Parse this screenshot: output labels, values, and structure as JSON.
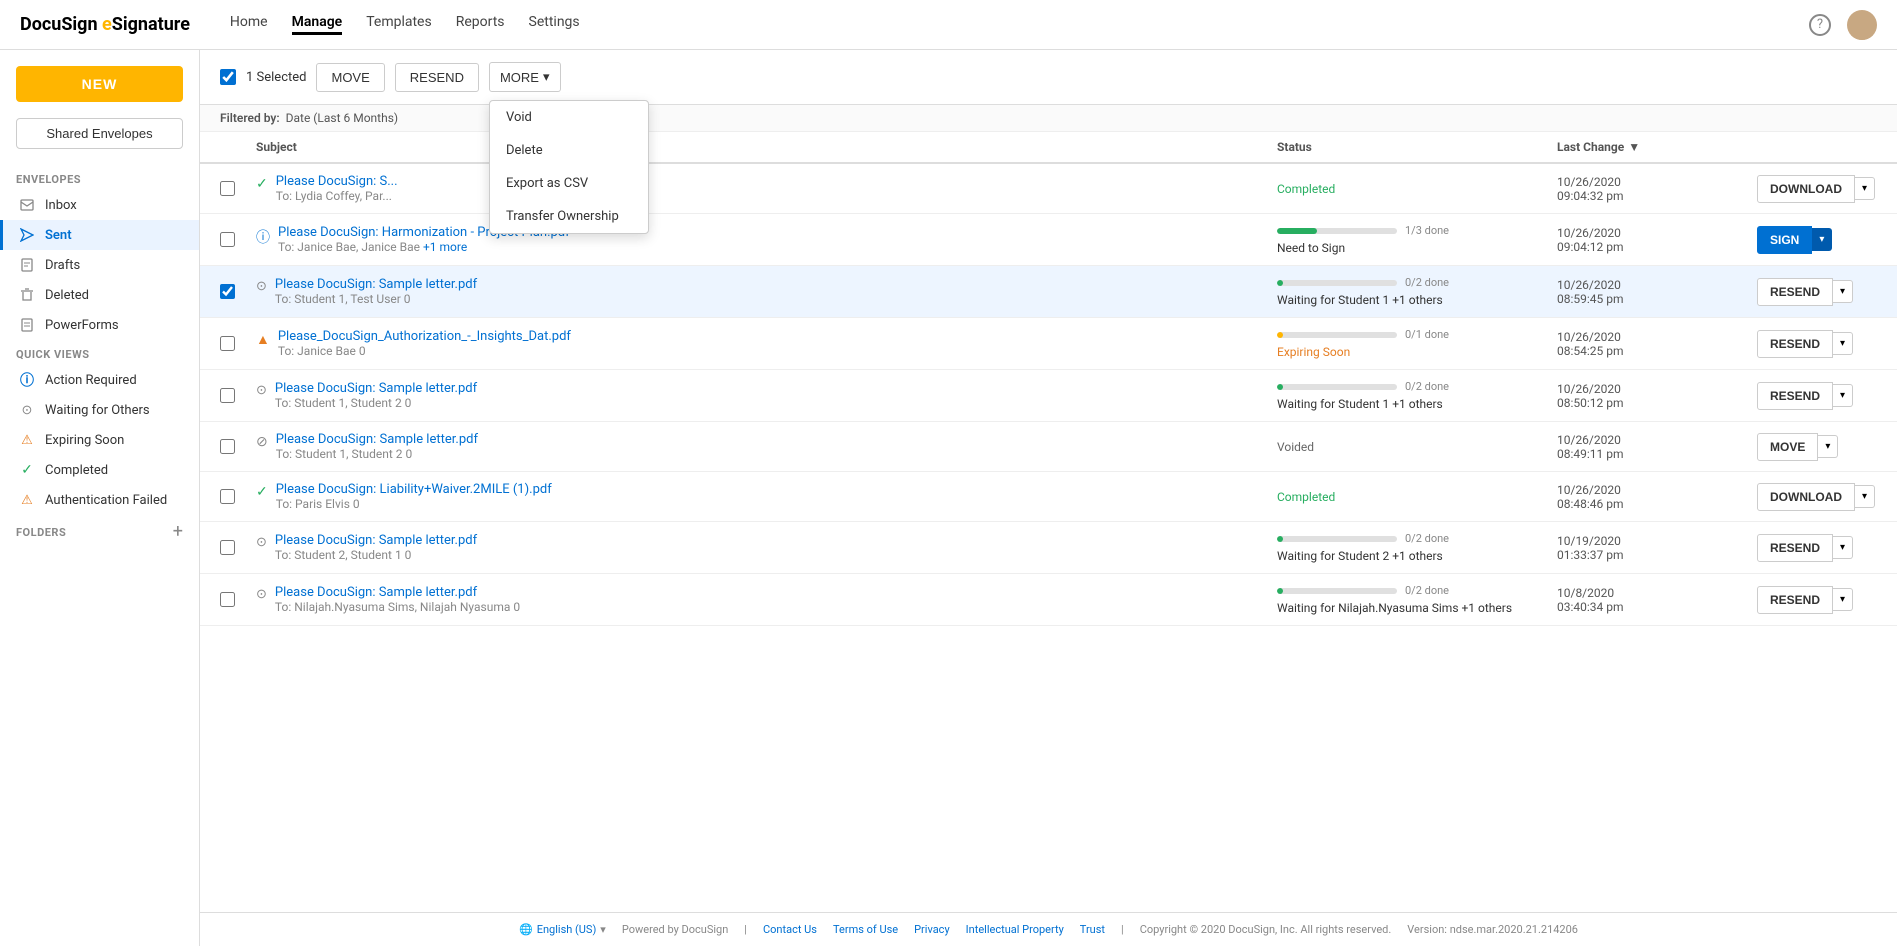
{
  "logo": {
    "brand": "DocuSign",
    "product": "eSignature"
  },
  "nav": {
    "links": [
      {
        "label": "Home",
        "active": false
      },
      {
        "label": "Manage",
        "active": true
      },
      {
        "label": "Templates",
        "active": false
      },
      {
        "label": "Reports",
        "active": false
      },
      {
        "label": "Settings",
        "active": false
      }
    ]
  },
  "sidebar": {
    "new_button": "NEW",
    "shared_button": "Shared Envelopes",
    "envelopes_label": "ENVELOPES",
    "envelopes_items": [
      {
        "id": "inbox",
        "label": "Inbox"
      },
      {
        "id": "sent",
        "label": "Sent",
        "active": true
      },
      {
        "id": "drafts",
        "label": "Drafts"
      },
      {
        "id": "deleted",
        "label": "Deleted"
      },
      {
        "id": "powerforms",
        "label": "PowerForms"
      }
    ],
    "quick_views_label": "QUICK VIEWS",
    "quick_views_items": [
      {
        "id": "action-required",
        "label": "Action Required"
      },
      {
        "id": "waiting-others",
        "label": "Waiting for Others"
      },
      {
        "id": "expiring-soon",
        "label": "Expiring Soon"
      },
      {
        "id": "completed",
        "label": "Completed"
      },
      {
        "id": "auth-failed",
        "label": "Authentication Failed"
      }
    ],
    "folders_label": "FOLDERS"
  },
  "toolbar": {
    "selected_count": "1 Selected",
    "move_label": "MOVE",
    "resend_label": "RESEND",
    "more_label": "MORE",
    "dropdown_items": [
      {
        "label": "Void"
      },
      {
        "label": "Delete"
      },
      {
        "label": "Export as CSV"
      },
      {
        "label": "Transfer Ownership"
      }
    ]
  },
  "filter_bar": {
    "label": "Filtered by:",
    "value": "Date (Last 6 Months)"
  },
  "table": {
    "headers": [
      "",
      "Subject",
      "Status",
      "Last Change",
      ""
    ],
    "rows": [
      {
        "id": "row1",
        "selected": false,
        "icon_type": "check-green",
        "subject": "Please DocuSign: S...",
        "to": "To: Lydia Coffey, Par...",
        "status_type": "completed",
        "status_text": "Completed",
        "progress": null,
        "progress_done": null,
        "progress_total": null,
        "date": "10/26/2020",
        "time": "09:04:32 pm",
        "action": "DOWNLOAD",
        "action_type": "download"
      },
      {
        "id": "row2",
        "selected": false,
        "icon_type": "info-blue",
        "subject": "Please DocuSign: Harmonization - Project Plan.pdf",
        "to": "To: Janice Bae, Janice Bae",
        "to_more": "+1 more",
        "status_type": "need-sign",
        "status_text": "Need to Sign",
        "progress": 33,
        "progress_done": "1/3",
        "progress_label": "done",
        "progress_color": "#27ae60",
        "date": "10/26/2020",
        "time": "09:04:12 pm",
        "action": "SIGN",
        "action_type": "sign"
      },
      {
        "id": "row3",
        "selected": true,
        "icon_type": "clock",
        "subject": "Please DocuSign: Sample letter.pdf",
        "to": "To: Student 1, Test User 0",
        "status_type": "waiting",
        "status_text": "Waiting for Student 1",
        "status_more": "+1 others",
        "progress": 5,
        "progress_done": "0/2",
        "progress_label": "done",
        "progress_color": "#27ae60",
        "date": "10/26/2020",
        "time": "08:59:45 pm",
        "action": "RESEND",
        "action_type": "resend"
      },
      {
        "id": "row4",
        "selected": false,
        "icon_type": "warn-yellow",
        "subject": "Please_DocuSign_Authorization_-_Insights_Dat.pdf",
        "to": "To: Janice Bae 0",
        "status_type": "expiring",
        "status_text": "Expiring Soon",
        "progress": 5,
        "progress_done": "0/1",
        "progress_label": "done",
        "progress_color": "#ffb500",
        "date": "10/26/2020",
        "time": "08:54:25 pm",
        "action": "RESEND",
        "action_type": "resend"
      },
      {
        "id": "row5",
        "selected": false,
        "icon_type": "clock",
        "subject": "Please DocuSign: Sample letter.pdf",
        "to": "To: Student 1, Student 2 0",
        "status_type": "waiting",
        "status_text": "Waiting for Student 1",
        "status_more": "+1 others",
        "progress": 5,
        "progress_done": "0/2",
        "progress_label": "done",
        "progress_color": "#27ae60",
        "date": "10/26/2020",
        "time": "08:50:12 pm",
        "action": "RESEND",
        "action_type": "resend"
      },
      {
        "id": "row6",
        "selected": false,
        "icon_type": "void",
        "subject": "Please DocuSign: Sample letter.pdf",
        "to": "To: Student 1, Student 2 0",
        "status_type": "voided",
        "status_text": "Voided",
        "progress": null,
        "date": "10/26/2020",
        "time": "08:49:11 pm",
        "action": "MOVE",
        "action_type": "move"
      },
      {
        "id": "row7",
        "selected": false,
        "icon_type": "check-green",
        "subject": "Please DocuSign: Liability+Waiver.2MILE (1).pdf",
        "to": "To: Paris Elvis 0",
        "status_type": "completed",
        "status_text": "Completed",
        "progress": null,
        "date": "10/26/2020",
        "time": "08:48:46 pm",
        "action": "DOWNLOAD",
        "action_type": "download"
      },
      {
        "id": "row8",
        "selected": false,
        "icon_type": "clock",
        "subject": "Please DocuSign: Sample letter.pdf",
        "to": "To: Student 2, Student 1 0",
        "status_type": "waiting",
        "status_text": "Waiting for Student 2",
        "status_more": "+1 others",
        "progress": 5,
        "progress_done": "0/2",
        "progress_label": "done",
        "progress_color": "#27ae60",
        "date": "10/19/2020",
        "time": "01:33:37 pm",
        "action": "RESEND",
        "action_type": "resend"
      },
      {
        "id": "row9",
        "selected": false,
        "icon_type": "clock",
        "subject": "Please DocuSign: Sample letter.pdf",
        "to": "To: Nilajah.Nyasuma Sims, Nilajah Nyasuma 0",
        "status_type": "waiting",
        "status_text": "Waiting for Nilajah.Nyasuma Sims",
        "status_more": "+1 others",
        "progress": 5,
        "progress_done": "0/2",
        "progress_label": "done",
        "progress_color": "#27ae60",
        "date": "10/8/2020",
        "time": "03:40:34 pm",
        "action": "RESEND",
        "action_type": "resend"
      }
    ]
  },
  "footer": {
    "globe_label": "English (US)",
    "powered_by": "Powered by DocuSign",
    "contact_us": "Contact Us",
    "terms": "Terms of Use",
    "privacy": "Privacy",
    "intellectual": "Intellectual Property",
    "trust": "Trust",
    "copyright": "Copyright © 2020 DocuSign, Inc. All rights reserved.",
    "version": "Version: ndse.mar.2020.21.214206"
  }
}
